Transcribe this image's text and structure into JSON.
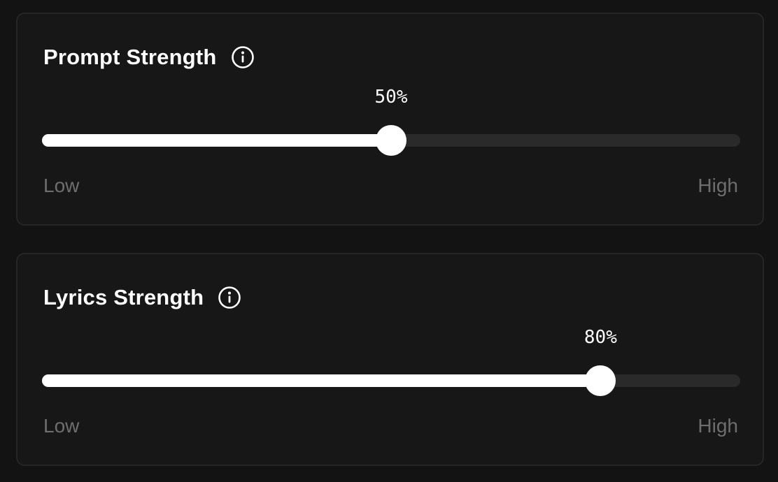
{
  "sliders": [
    {
      "title": "Prompt Strength",
      "value_label": "50%",
      "value": 0.5,
      "low_label": "Low",
      "high_label": "High",
      "info_icon": "info-circle-icon"
    },
    {
      "title": "Lyrics Strength",
      "value_label": "80%",
      "value": 0.8,
      "low_label": "Low",
      "high_label": "High",
      "info_icon": "info-circle-icon"
    }
  ],
  "colors": {
    "background": "#131313",
    "panel": "#171717",
    "panel_border": "#262626",
    "track": "#2a2a2b",
    "fill": "#ffffff",
    "muted_text": "#6e6e70"
  }
}
